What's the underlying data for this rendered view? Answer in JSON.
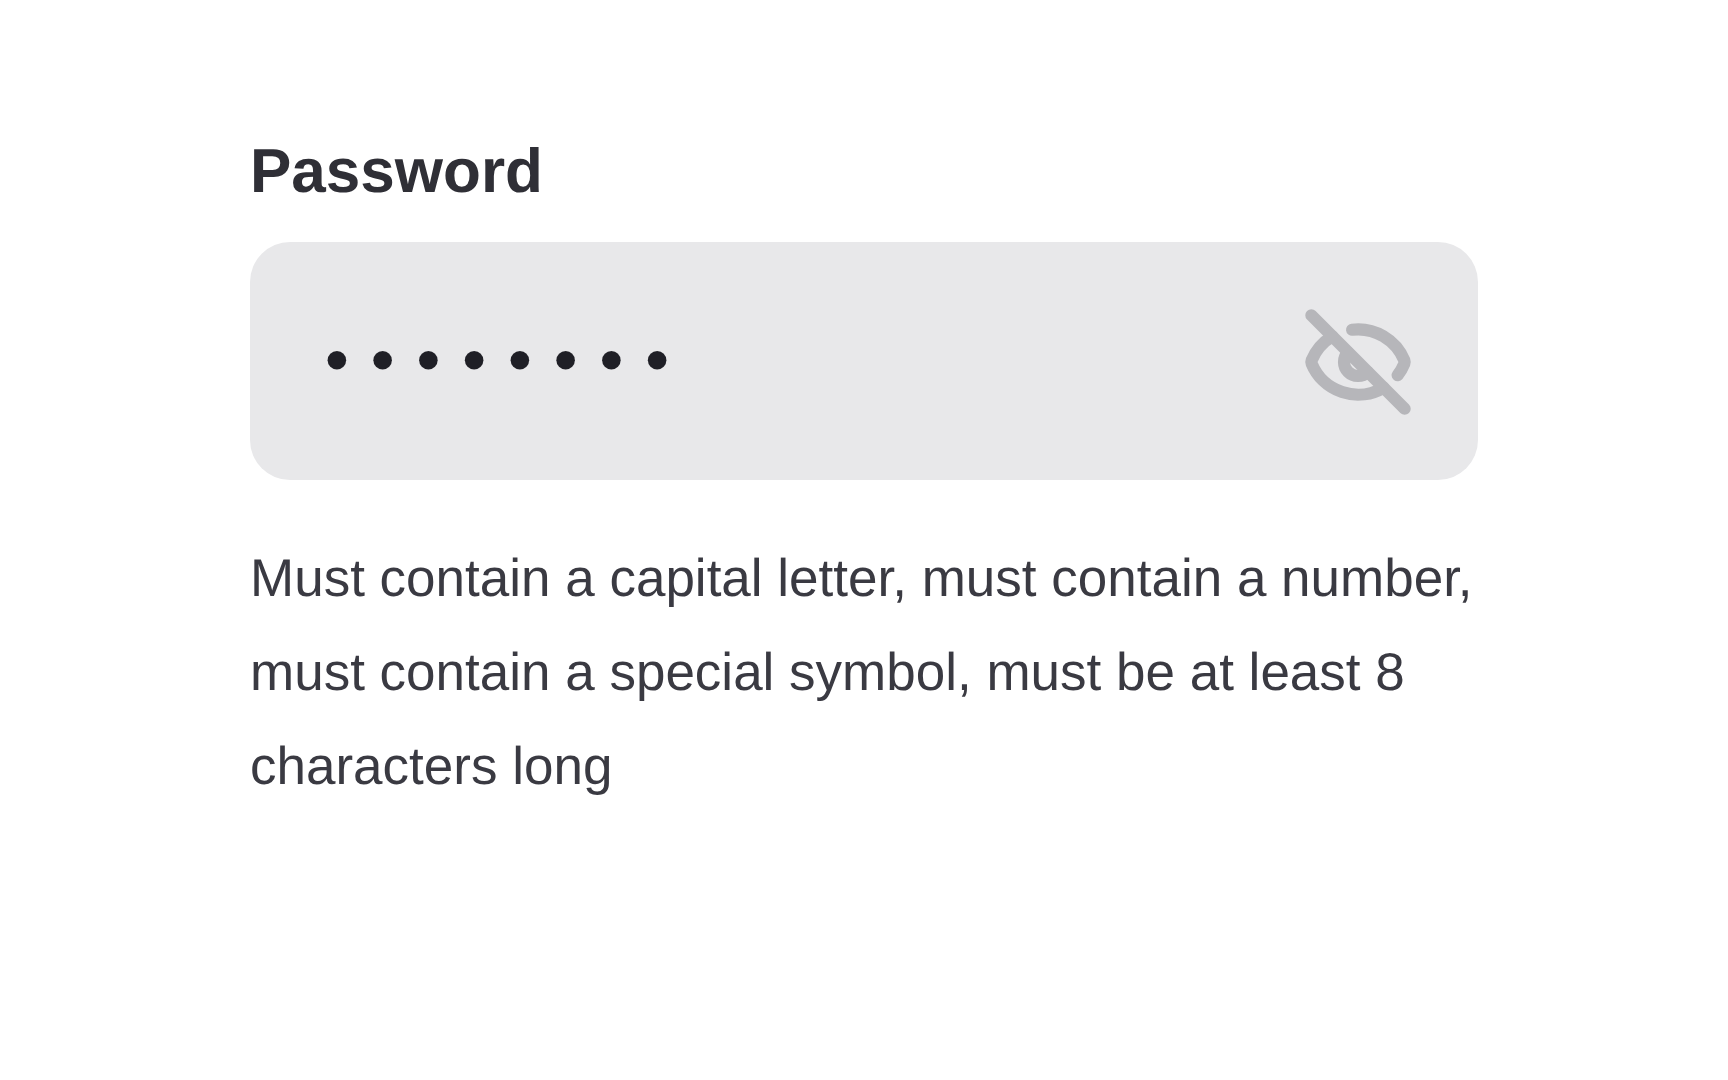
{
  "password_field": {
    "label": "Password",
    "value": "••••••••",
    "visible": false
  },
  "hint": "Must contain a capital letter, must contain a number, must contain a special symbol, must be at least 8 characters long"
}
